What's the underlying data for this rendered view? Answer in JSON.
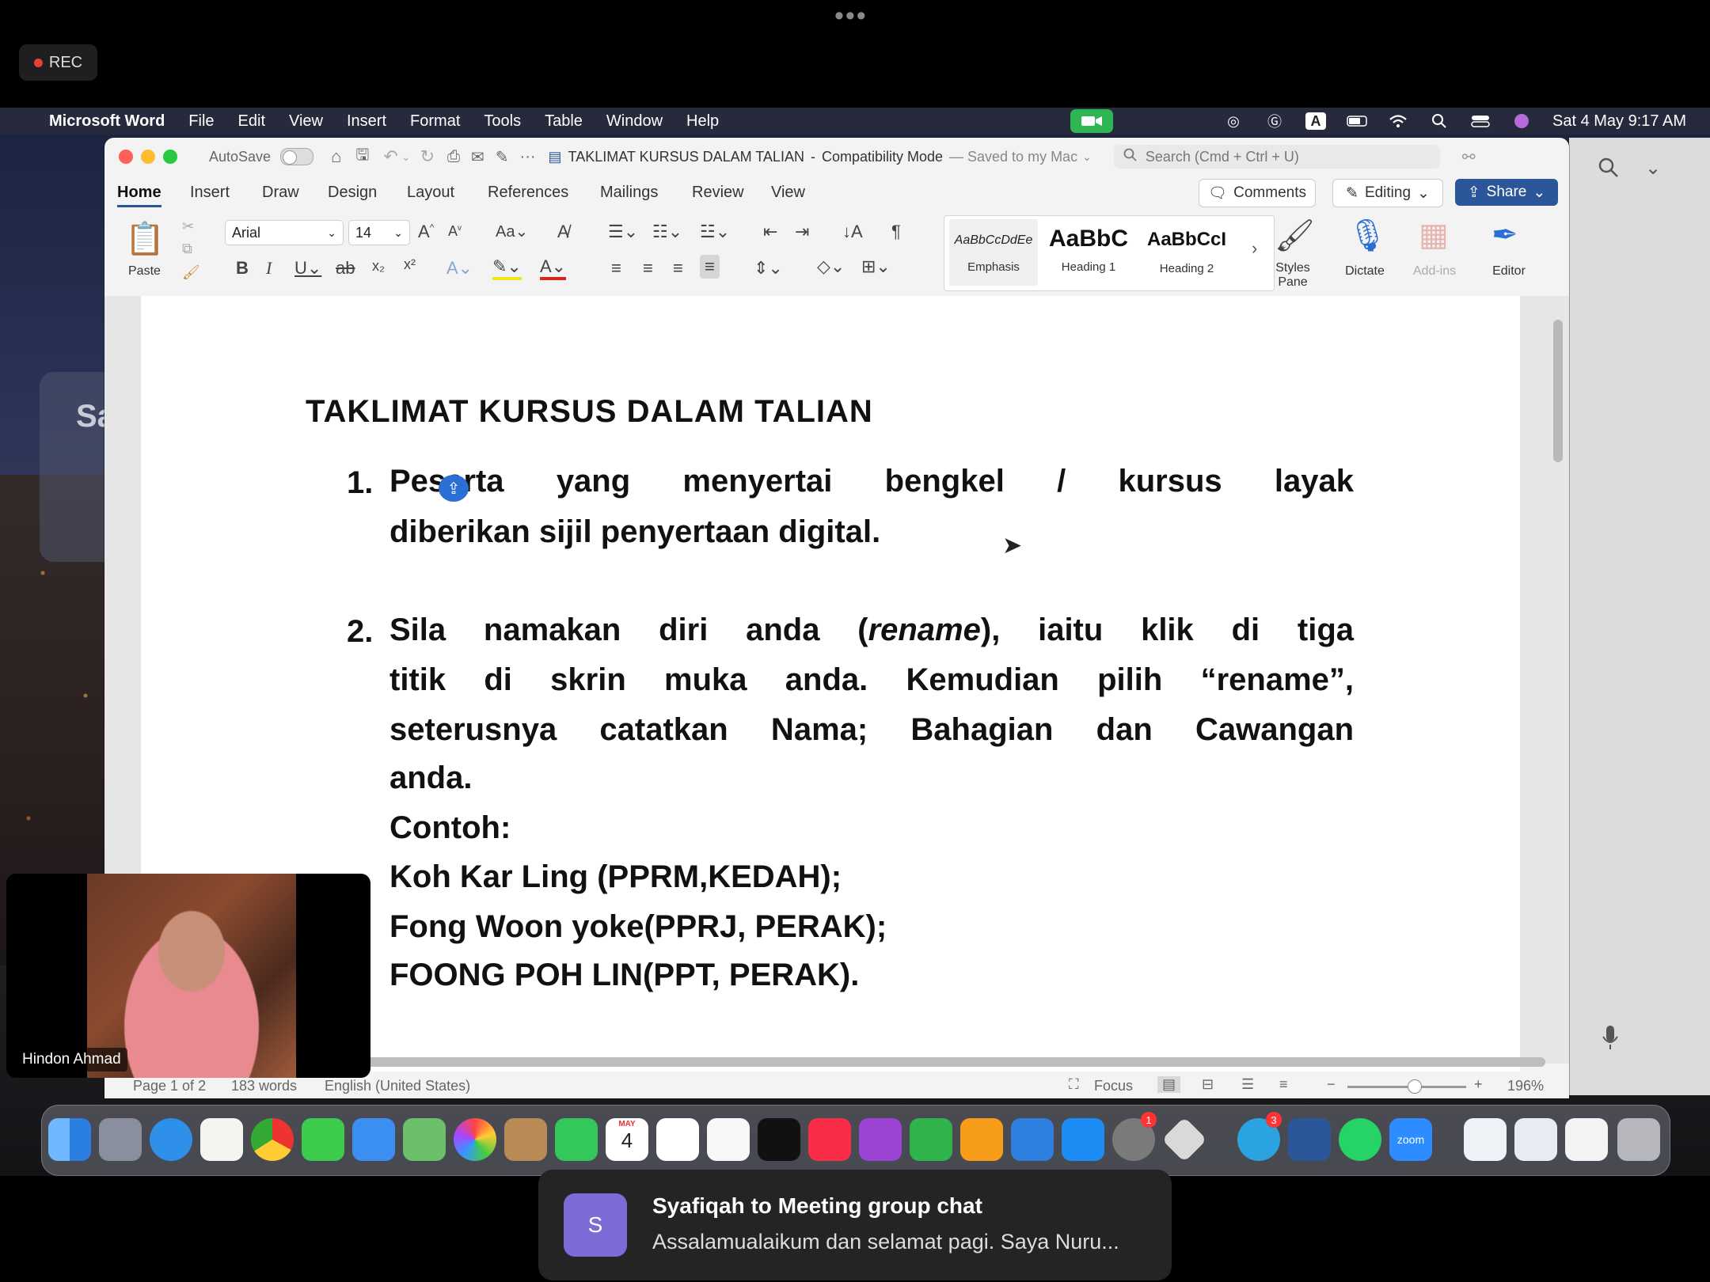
{
  "zoom": {
    "more_icon": "more-dots-icon",
    "rec_label": "REC",
    "self_view_name": "Hindon Ahmad"
  },
  "menubar": {
    "app_name": "Microsoft Word",
    "items": [
      "File",
      "Edit",
      "View",
      "Insert",
      "Format",
      "Tools",
      "Table",
      "Window",
      "Help"
    ],
    "datetime": "Sat 4 May  9:17 AM"
  },
  "word": {
    "autosave_label": "AutoSave",
    "doc_title": "TAKLIMAT KURSUS DALAM TALIAN",
    "mode": "Compatibility Mode",
    "saved_status": "— Saved to my Mac",
    "search_placeholder": "Search (Cmd + Ctrl + U)",
    "tabs": [
      "Home",
      "Insert",
      "Draw",
      "Design",
      "Layout",
      "References",
      "Mailings",
      "Review",
      "View"
    ],
    "active_tab": "Home",
    "comments_label": "Comments",
    "editing_label": "Editing",
    "share_label": "Share",
    "ribbon": {
      "paste_label": "Paste",
      "font_name": "Arial",
      "font_size": "14",
      "styles": [
        {
          "preview": "AaBbCcDdEe",
          "name": "Emphasis"
        },
        {
          "preview": "AaBbC",
          "name": "Heading 1"
        },
        {
          "preview": "AaBbCcI",
          "name": "Heading 2"
        }
      ],
      "styles_pane_label": "Styles Pane",
      "dictate_label": "Dictate",
      "addins_label": "Add-ins",
      "editor_label": "Editor"
    },
    "status": {
      "page": "Page 1 of 2",
      "words": "183 words",
      "language": "English (United States)",
      "focus_label": "Focus",
      "zoom": "196%"
    }
  },
  "document": {
    "title": "TAKLIMAT KURSUS DALAM TALIAN",
    "item1_num": "1.",
    "item1_lines": [
      "Peserta yang menyertai bengkel / kursus layak",
      "diberikan sijil penyertaan digital."
    ],
    "item2_num": "2.",
    "item2_line1_pre": "Sila namakan diri  anda (",
    "item2_line1_italic": "rename",
    "item2_line1_post": "), iaitu klik di tiga",
    "item2_lines": [
      "titik di skrin muka anda. Kemudian pilih “rename”,",
      "seterusnya catatkan Nama; Bahagian dan Cawangan",
      "anda."
    ],
    "example_label": "Contoh:",
    "examples": [
      "Koh Kar Ling (PPRM,KEDAH);",
      "Fong Woon yoke(PPRJ, PERAK);",
      "FOONG POH LIN(PPT, PERAK)."
    ]
  },
  "toast": {
    "avatar_letter": "S",
    "title": "Syafiqah to Meeting group chat",
    "message": "Assalamualaikum dan selamat pagi. Saya Nuru..."
  },
  "dock": {
    "calendar_month": "MAY",
    "calendar_day": "4",
    "zoom_label": "zoom",
    "settings_badge": "1",
    "telegram_badge": "3"
  }
}
